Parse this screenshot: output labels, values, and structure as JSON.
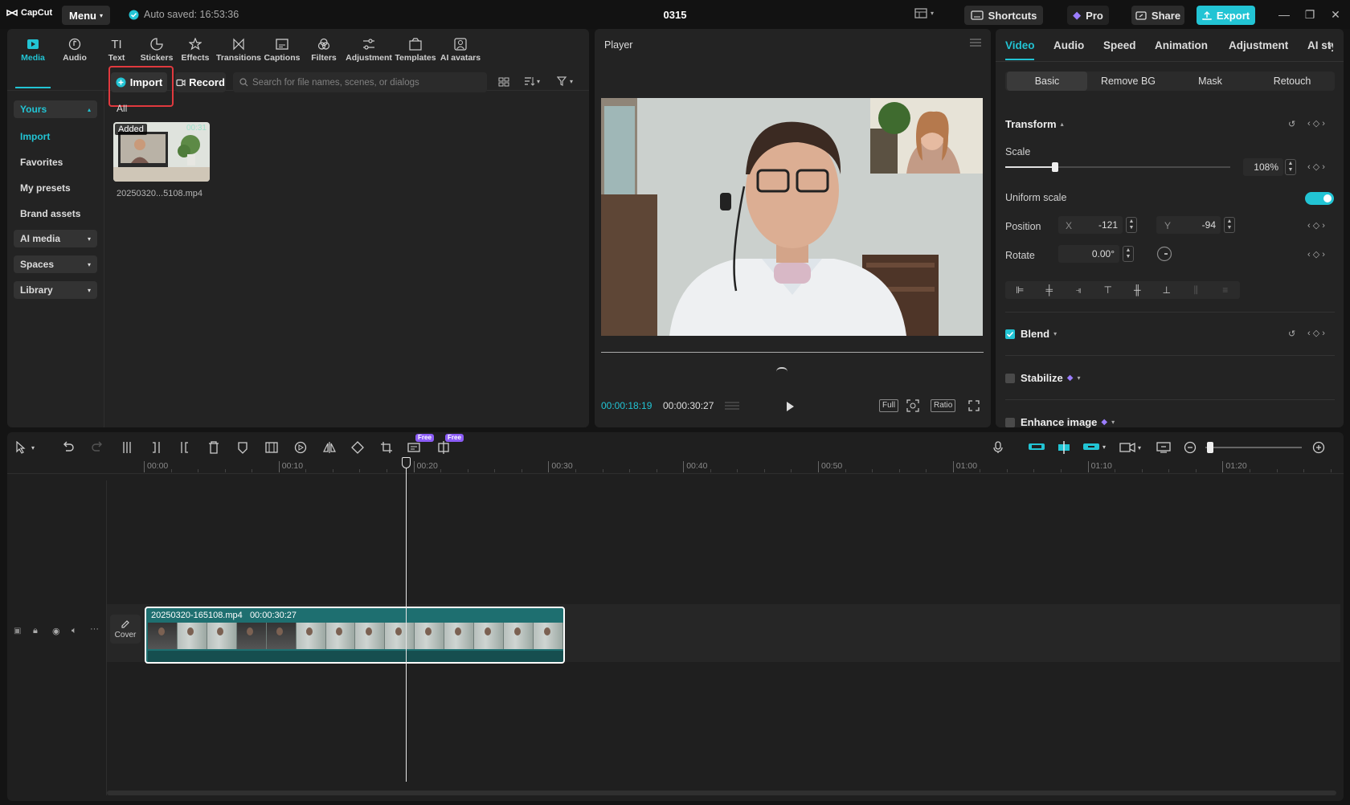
{
  "titlebar": {
    "logo": "CapCut",
    "menu_label": "Menu",
    "autosave": "Auto saved: 16:53:36",
    "project_title": "0315",
    "shortcuts": "Shortcuts",
    "pro": "Pro",
    "share": "Share",
    "export": "Export"
  },
  "tool_tabs": [
    {
      "label": "Media",
      "icon": "media-icon"
    },
    {
      "label": "Audio",
      "icon": "audio-icon"
    },
    {
      "label": "Text",
      "icon": "text-icon"
    },
    {
      "label": "Stickers",
      "icon": "stickers-icon"
    },
    {
      "label": "Effects",
      "icon": "effects-icon"
    },
    {
      "label": "Transitions",
      "icon": "transitions-icon"
    },
    {
      "label": "Captions",
      "icon": "captions-icon"
    },
    {
      "label": "Filters",
      "icon": "filters-icon"
    },
    {
      "label": "Adjustment",
      "icon": "adjustment-icon"
    },
    {
      "label": "Templates",
      "icon": "templates-icon"
    },
    {
      "label": "AI avatars",
      "icon": "ai-avatars-icon"
    }
  ],
  "sidebar": {
    "yours": "Yours",
    "import": "Import",
    "favorites": "Favorites",
    "my_presets": "My presets",
    "brand_assets": "Brand assets",
    "ai_media": "AI media",
    "spaces": "Spaces",
    "library": "Library"
  },
  "media": {
    "import_btn": "Import",
    "record_btn": "Record",
    "search_placeholder": "Search for file names, scenes, or dialogs",
    "filter_all": "All",
    "item_badge": "Added",
    "item_duration": "00:31",
    "item_name": "20250320...5108.mp4"
  },
  "player": {
    "title": "Player",
    "current_time": "00:00:18:19",
    "total_time": "00:00:30:27",
    "full_btn": "Full",
    "ratio_btn": "Ratio"
  },
  "properties": {
    "tabs": [
      "Video",
      "Audio",
      "Speed",
      "Animation",
      "Adjustment",
      "AI styli"
    ],
    "subtabs": [
      "Basic",
      "Remove BG",
      "Mask",
      "Retouch"
    ],
    "transform": "Transform",
    "scale_label": "Scale",
    "scale_value": "108%",
    "scale_fraction": 0.22,
    "uniform_scale": "Uniform scale",
    "position_label": "Position",
    "x_label": "X",
    "x_value": "-121",
    "y_label": "Y",
    "y_value": "-94",
    "rotate_label": "Rotate",
    "rotate_value": "0.00°",
    "blend": "Blend",
    "stabilize": "Stabilize",
    "enhance_image": "Enhance image"
  },
  "timeline": {
    "ticks": [
      "00:00",
      "00:10",
      "00:20",
      "00:30",
      "00:40",
      "00:50",
      "01:00",
      "01:10",
      "01:20"
    ],
    "free_badge": "Free",
    "clip_name": "20250320-165108.mp4",
    "clip_duration": "00:00:30:27",
    "cover": "Cover"
  },
  "colors": {
    "accent": "#22c4d4",
    "highlight": "#e0393e",
    "clip": "#1e6f70"
  }
}
